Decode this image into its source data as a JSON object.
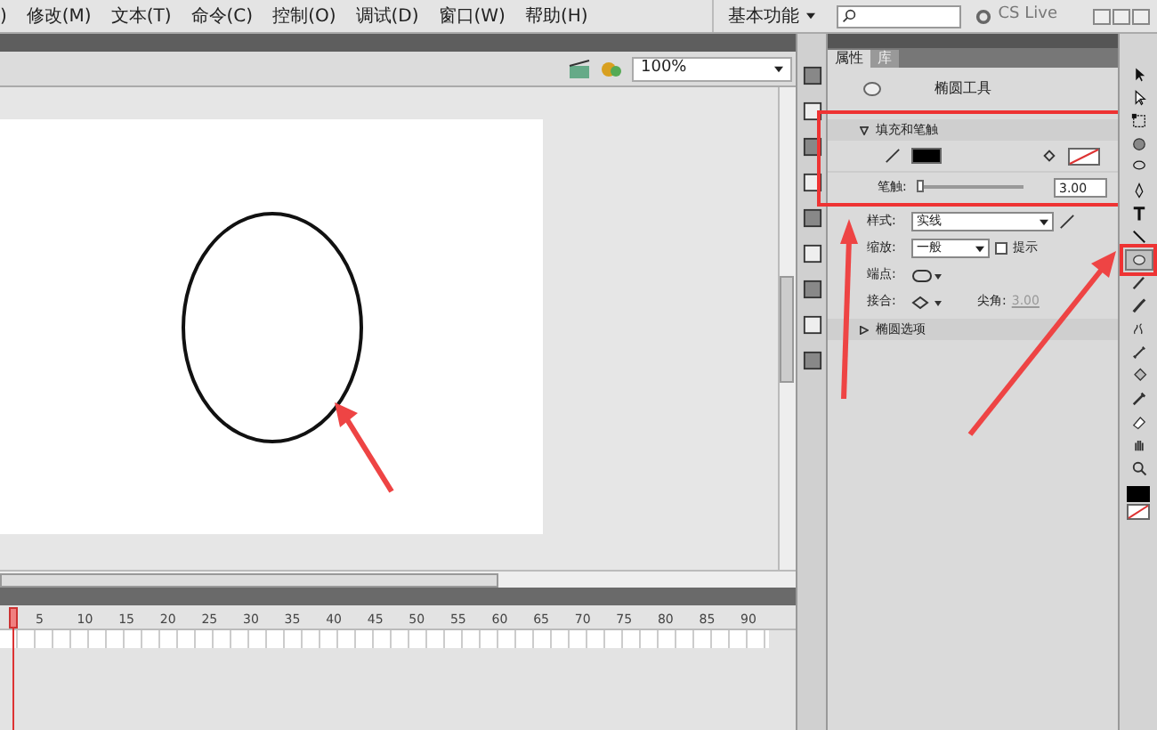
{
  "menu_bar": {
    "items": [
      ")",
      "修改(M)",
      "文本(T)",
      "命令(C)",
      "控制(O)",
      "调试(D)",
      "窗口(W)",
      "帮助(H)"
    ],
    "workspace": "基本功能",
    "cs_live": "CS Live"
  },
  "stage_toolbar": {
    "zoom": "100%"
  },
  "timeline": {
    "frame_numbers": [
      "5",
      "10",
      "15",
      "20",
      "25",
      "30",
      "35",
      "40",
      "45",
      "50",
      "55",
      "60",
      "65",
      "70",
      "75",
      "80",
      "85",
      "90"
    ]
  },
  "properties": {
    "tabs": [
      {
        "label": "属性",
        "selected": true
      },
      {
        "label": "库",
        "selected": false
      }
    ],
    "tool_name": "椭圆工具",
    "sections": [
      {
        "title": "填充和笔触",
        "expanded": true
      },
      {
        "title": "椭圆选项",
        "expanded": false
      }
    ],
    "stroke_label": "笔触:",
    "stroke_slider": {
      "level": 0.0
    },
    "stroke_value": "3.00",
    "style_label": "样式:",
    "style_value": "实线",
    "scale_label": "缩放:",
    "scale_value": "一般",
    "hint_label": "提示",
    "hint_checked": false,
    "cap_label": "端点:",
    "join_label": "接合:",
    "miter_label": "尖角:",
    "miter_value": "3.00",
    "miter_disabled": true
  },
  "tools": [
    {
      "kind": "arrow",
      "selected": false
    },
    {
      "kind": "subselect",
      "selected": false
    },
    {
      "kind": "transform",
      "selected": false
    },
    {
      "kind": "sphere",
      "selected": false
    },
    {
      "kind": "lasso",
      "selected": false
    },
    {
      "kind": "pen",
      "selected": false
    },
    {
      "kind": "text",
      "selected": false
    },
    {
      "kind": "line",
      "selected": false
    },
    {
      "kind": "oval",
      "selected": true
    },
    {
      "kind": "pencil",
      "selected": false
    },
    {
      "kind": "brush",
      "selected": false
    },
    {
      "kind": "deco",
      "selected": false
    },
    {
      "kind": "bone",
      "selected": false
    },
    {
      "kind": "bucket",
      "selected": false
    },
    {
      "kind": "eyedropper",
      "selected": false
    },
    {
      "kind": "eraser",
      "selected": false
    },
    {
      "kind": "hand",
      "selected": false
    },
    {
      "kind": "zoom",
      "selected": false
    }
  ]
}
